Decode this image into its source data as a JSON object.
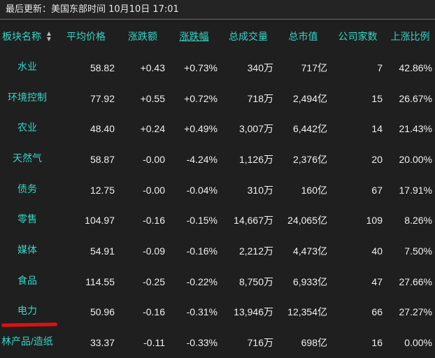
{
  "header": {
    "update_text": "最后更新：美国东部时间 10月10日 17:01"
  },
  "table": {
    "columns": [
      "板块名称",
      "平均价格",
      "涨跌额",
      "涨跌幅",
      "总成交量",
      "总市值",
      "公司家数",
      "上涨比例"
    ],
    "rows": [
      [
        "水业",
        "58.82",
        "+0.43",
        "+0.73%",
        "340万",
        "717亿",
        "7",
        "42.86%"
      ],
      [
        "环境控制",
        "77.92",
        "+0.55",
        "+0.72%",
        "718万",
        "2,494亿",
        "15",
        "26.67%"
      ],
      [
        "农业",
        "48.40",
        "+0.24",
        "+0.49%",
        "3,007万",
        "6,442亿",
        "14",
        "21.43%"
      ],
      [
        "天然气",
        "58.87",
        "-0.00",
        "-4.24%",
        "1,126万",
        "2,376亿",
        "20",
        "20.00%"
      ],
      [
        "债务",
        "12.75",
        "-0.00",
        "-0.04%",
        "310万",
        "160亿",
        "67",
        "17.91%"
      ],
      [
        "零售",
        "104.97",
        "-0.16",
        "-0.15%",
        "14,667万",
        "24,065亿",
        "109",
        "8.26%"
      ],
      [
        "媒体",
        "54.91",
        "-0.09",
        "-0.16%",
        "2,212万",
        "4,473亿",
        "40",
        "7.50%"
      ],
      [
        "食品",
        "114.55",
        "-0.25",
        "-0.22%",
        "8,750万",
        "6,933亿",
        "47",
        "27.66%"
      ],
      [
        "电力",
        "50.96",
        "-0.16",
        "-0.31%",
        "13,946万",
        "12,354亿",
        "66",
        "27.27%"
      ],
      [
        "林产品/造纸",
        "33.37",
        "-0.11",
        "-0.33%",
        "716万",
        "698亿",
        "16",
        "0.00%"
      ]
    ]
  },
  "colors": {
    "accent": "#35d6c6",
    "background": "#1f1f1f",
    "annotation": "#e01010"
  }
}
